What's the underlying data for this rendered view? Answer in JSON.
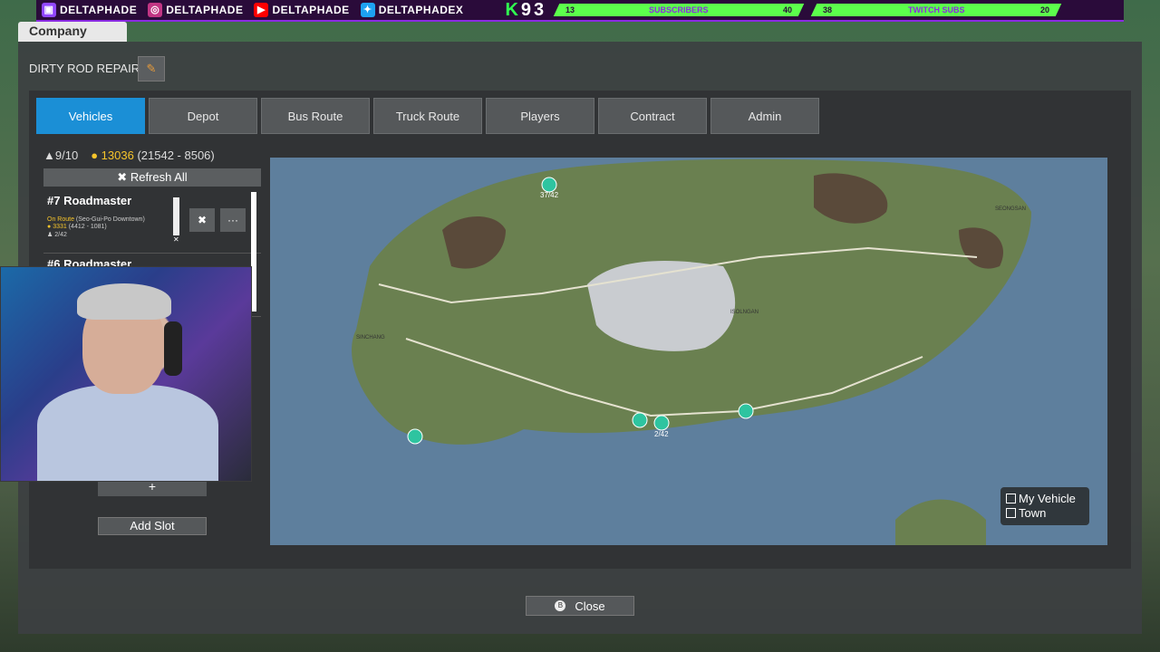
{
  "overlay": {
    "socials": [
      {
        "icon": "twitch-icon",
        "handle": "DELTAPHADE"
      },
      {
        "icon": "instagram-icon",
        "handle": "DELTAPHADE"
      },
      {
        "icon": "youtube-icon",
        "handle": "DELTAPHADE"
      },
      {
        "icon": "twitter-icon",
        "handle": "DELTAPHADEX"
      }
    ],
    "k93": [
      "K",
      "9",
      "3"
    ],
    "subscribers": {
      "current": "13",
      "label": "SUBSCRIBERS",
      "goal": "40"
    },
    "twitch_subs": {
      "current": "38",
      "label": "TWITCH SUBS",
      "goal": "20"
    },
    "accent": "#8a2be2",
    "stat_color": "#5cff4c"
  },
  "window": {
    "tab_label": "Company",
    "company_name": "DIRTY ROD REPAIR",
    "edit_icon": "pencil-icon"
  },
  "tabs": [
    {
      "label": "Vehicles",
      "active": true
    },
    {
      "label": "Depot",
      "active": false
    },
    {
      "label": "Bus Route",
      "active": false
    },
    {
      "label": "Truck Route",
      "active": false
    },
    {
      "label": "Players",
      "active": false
    },
    {
      "label": "Contract",
      "active": false
    },
    {
      "label": "Admin",
      "active": false
    }
  ],
  "summary": {
    "vehicle_count": "9/10",
    "money": "13036",
    "money_detail": "(21542 - 8506)"
  },
  "refresh_label": "Refresh All",
  "vehicles": [
    {
      "title": "#7 Roadmaster",
      "status": "On Route",
      "location": "(Seo-Gui-Po Downtown)",
      "earnings": "3331",
      "earnings_detail": "(4412 - 1081)",
      "passengers": "2/42"
    },
    {
      "title": "#6 Roadmaster"
    }
  ],
  "add_slot_label": "Add Slot",
  "plus_label": "+",
  "map": {
    "labels": {
      "bus_a": "37/42",
      "bus_b": "2/42",
      "sinchang": "SINCHANG",
      "seongsan": "SEONGSAN",
      "isollgan": "ISOLNGAN"
    },
    "legend": [
      {
        "label": "My Vehicle",
        "checked": false
      },
      {
        "label": "Town",
        "checked": false
      }
    ],
    "water": "#5e7f9d",
    "land": "#6a8050"
  },
  "close_label": "Close",
  "close_key": "B",
  "accent": "#1b8fd6"
}
